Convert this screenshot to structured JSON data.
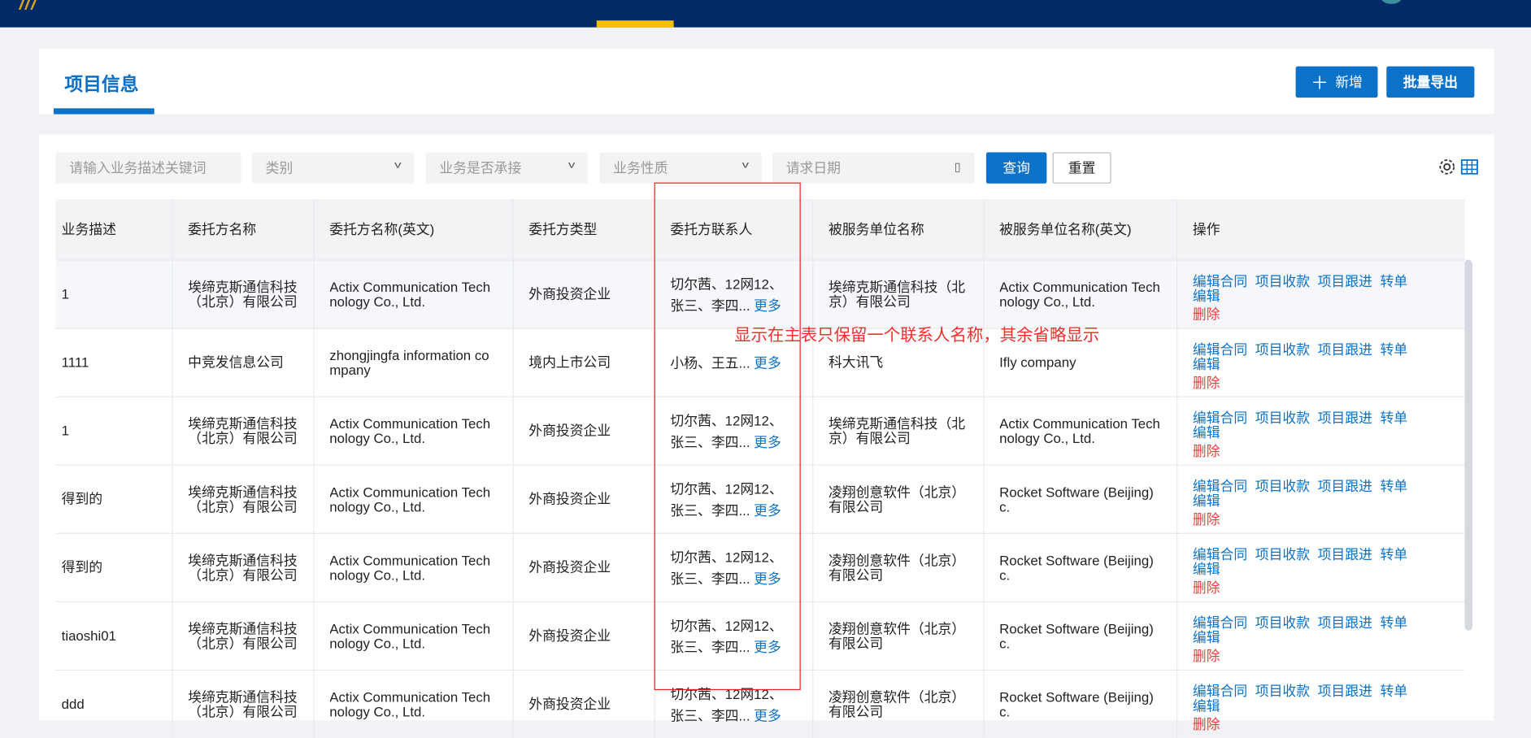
{
  "page": {
    "title": "项目信息",
    "add_label": "新增",
    "add_icon": "plus-icon",
    "export_label": "批量导出"
  },
  "filters": {
    "keyword_placeholder": "请输入业务描述关键词",
    "category": "类别",
    "undertaken": "业务是否承接",
    "nature": "业务性质",
    "date": "请求日期",
    "query": "查询",
    "reset": "重置"
  },
  "table": {
    "columns": [
      "业务描述",
      "委托方名称",
      "委托方名称(英文)",
      "委托方类型",
      "委托方联系人",
      "被服务单位名称",
      "被服务单位名称(英文)",
      "操作"
    ],
    "actions": [
      "编辑合同",
      "项目收款",
      "项目跟进",
      "转单",
      "编辑",
      "删除"
    ],
    "more": "更多",
    "rows": [
      {
        "desc": "1",
        "client": "埃缔克斯通信科技（北京）有限公司",
        "client_en": "Actix Communication Technology Co., Ltd.",
        "type": "外商投资企业",
        "contacts": "切尔茜、12网12、张三、李四...",
        "served": "埃缔克斯通信科技（北京）有限公司",
        "served_en": "Actix Communication Technology Co., Ltd."
      },
      {
        "desc": "1111",
        "client": "中竞发信息公司",
        "client_en": "zhongjingfa information company",
        "type": "境内上市公司",
        "contacts": "小杨、王五...",
        "served": "科大讯飞",
        "served_en": "Ifly company"
      },
      {
        "desc": "1",
        "client": "埃缔克斯通信科技（北京）有限公司",
        "client_en": "Actix Communication Technology Co., Ltd.",
        "type": "外商投资企业",
        "contacts": "切尔茜、12网12、张三、李四...",
        "served": "埃缔克斯通信科技（北京）有限公司",
        "served_en": "Actix Communication Technology Co., Ltd."
      },
      {
        "desc": "得到的",
        "client": "埃缔克斯通信科技（北京）有限公司",
        "client_en": "Actix Communication Technology Co., Ltd.",
        "type": "外商投资企业",
        "contacts": "切尔茜、12网12、张三、李四...",
        "served": "凌翔创意软件（北京）有限公司",
        "served_en": "Rocket Software (Beijing) c."
      },
      {
        "desc": "得到的",
        "client": "埃缔克斯通信科技（北京）有限公司",
        "client_en": "Actix Communication Technology Co., Ltd.",
        "type": "外商投资企业",
        "contacts": "切尔茜、12网12、张三、李四...",
        "served": "凌翔创意软件（北京）有限公司",
        "served_en": "Rocket Software (Beijing) c."
      },
      {
        "desc": "tiaoshi01",
        "client": "埃缔克斯通信科技（北京）有限公司",
        "client_en": "Actix Communication Technology Co., Ltd.",
        "type": "外商投资企业",
        "contacts": "切尔茜、12网12、张三、李四...",
        "served": "凌翔创意软件（北京）有限公司",
        "served_en": "Rocket Software (Beijing) c."
      },
      {
        "desc": "ddd",
        "client": "埃缔克斯通信科技（北京）有限公司",
        "client_en": "Actix Communication Technology Co., Ltd.",
        "type": "外商投资企业",
        "contacts": "切尔茜、12网12、张三、李四...",
        "served": "凌翔创意软件（北京）有限公司",
        "served_en": "Rocket Software (Beijing) c."
      }
    ]
  },
  "annotation": "显示在主表只保留一个联系人名称，其余省略显示",
  "colors": {
    "nav": "#012a66",
    "accent": "#0b72c9",
    "danger": "#f03c3c",
    "annotation": "#e8201e",
    "active_tab": "#f5c000"
  }
}
